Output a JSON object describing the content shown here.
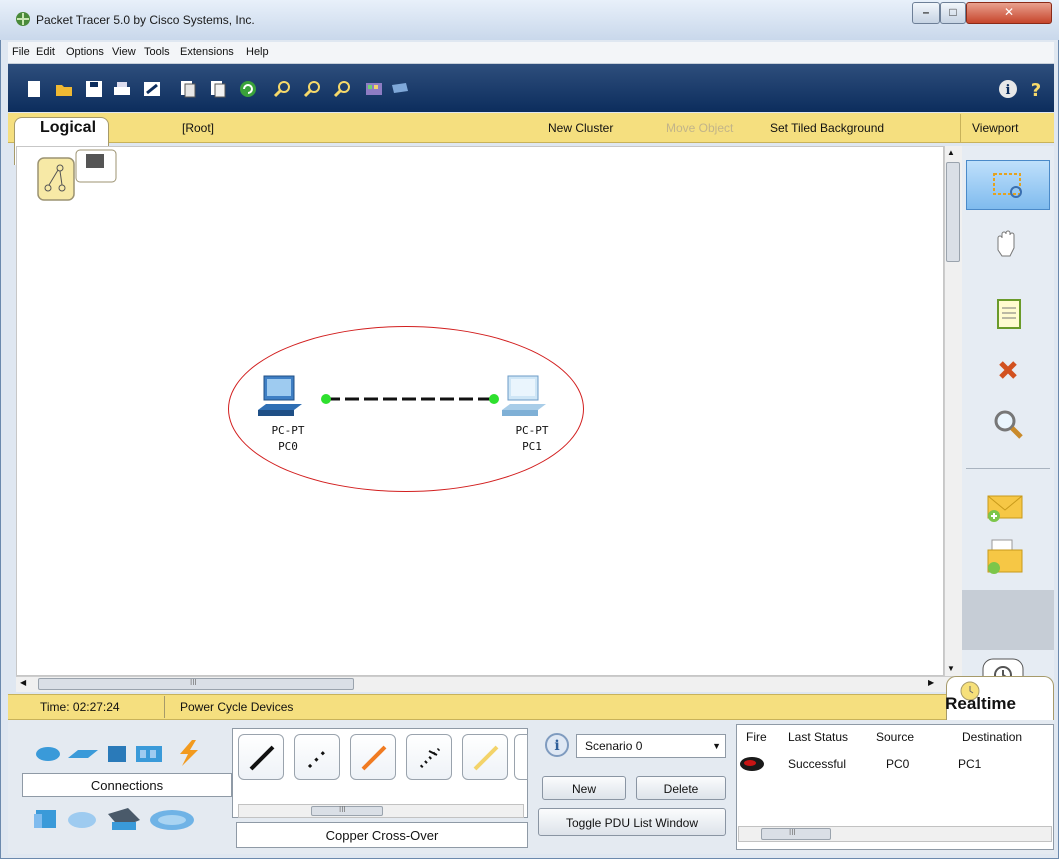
{
  "window": {
    "title": "Packet Tracer 5.0 by Cisco Systems, Inc."
  },
  "menu": [
    "File",
    "Edit",
    "Options",
    "View",
    "Tools",
    "Extensions",
    "Help"
  ],
  "workspace": {
    "tab_label": "Logical",
    "path": "[Root]",
    "new_cluster": "New Cluster",
    "move_object": "Move Object",
    "set_tiled_background": "Set Tiled Background",
    "viewport": "Viewport"
  },
  "devices": [
    {
      "type": "PC-PT",
      "name": "PC0"
    },
    {
      "type": "PC-PT",
      "name": "PC1"
    }
  ],
  "status": {
    "time": "Time: 02:27:24",
    "power_cycle": "Power Cycle Devices",
    "mode": "Realtime"
  },
  "device_panel": {
    "category_label": "Connections"
  },
  "cable_panel": {
    "selected_label": "Copper Cross-Over"
  },
  "scenario": {
    "selected": "Scenario 0",
    "new_label": "New",
    "delete_label": "Delete",
    "toggle_label": "Toggle PDU List Window"
  },
  "pdu_table": {
    "headers": [
      "Fire",
      "Last Status",
      "Source",
      "Destination"
    ],
    "rows": [
      {
        "last_status": "Successful",
        "source": "PC0",
        "destination": "PC1"
      }
    ]
  },
  "scroll_grip": "III",
  "colors": {
    "accent_bar": "#f5df7f",
    "toolbar": "#0c2d5d",
    "annotation": "#d21f1f",
    "link_dot": "#2ee02e"
  }
}
